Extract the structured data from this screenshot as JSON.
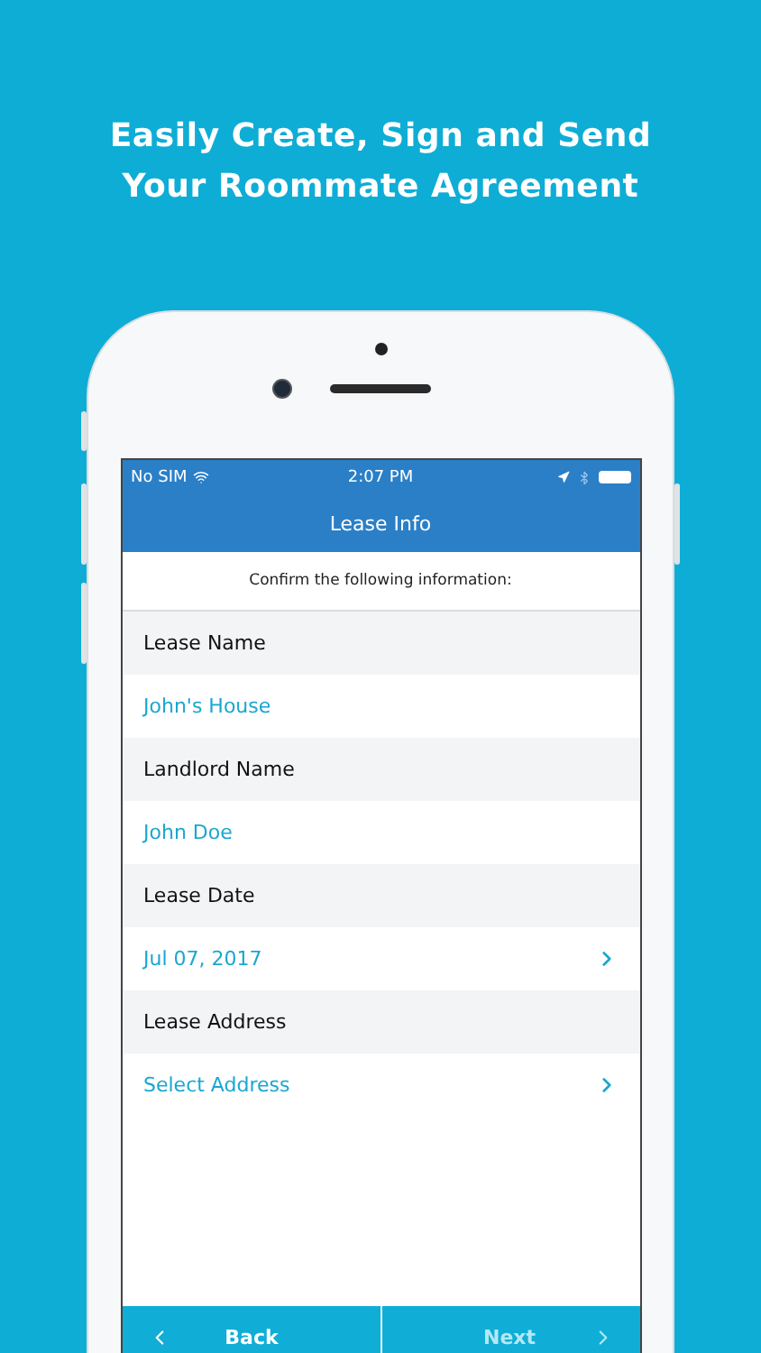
{
  "headline": [
    "Easily Create, Sign and Send",
    "Your Roommate Agreement"
  ],
  "status_bar": {
    "carrier": "No SIM",
    "time": "2:07 PM"
  },
  "nav_title": "Lease Info",
  "instruction": "Confirm the following information:",
  "fields": [
    {
      "label": "Lease Name",
      "value": "John's House",
      "chevron": false
    },
    {
      "label": "Landlord Name",
      "value": "John Doe",
      "chevron": false
    },
    {
      "label": "Lease Date",
      "value": "Jul 07, 2017",
      "chevron": true
    },
    {
      "label": "Lease Address",
      "value": "Select Address",
      "chevron": true
    }
  ],
  "footer": [
    {
      "kind": "back",
      "label": "Back",
      "disabled": false
    },
    {
      "kind": "next",
      "label": "Next",
      "disabled": true
    }
  ]
}
